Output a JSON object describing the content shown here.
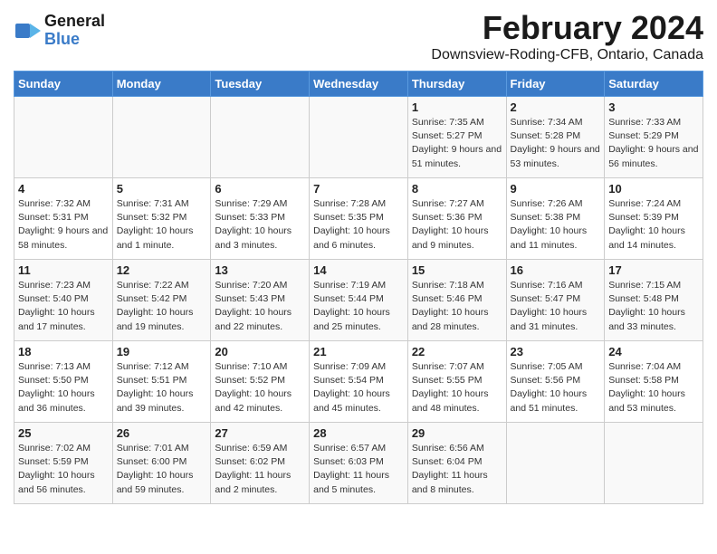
{
  "header": {
    "logo_line1": "General",
    "logo_line2": "Blue",
    "title": "February 2024",
    "subtitle": "Downsview-Roding-CFB, Ontario, Canada"
  },
  "days_of_week": [
    "Sunday",
    "Monday",
    "Tuesday",
    "Wednesday",
    "Thursday",
    "Friday",
    "Saturday"
  ],
  "weeks": [
    [
      {
        "day": "",
        "info": ""
      },
      {
        "day": "",
        "info": ""
      },
      {
        "day": "",
        "info": ""
      },
      {
        "day": "",
        "info": ""
      },
      {
        "day": "1",
        "info": "Sunrise: 7:35 AM\nSunset: 5:27 PM\nDaylight: 9 hours and 51 minutes."
      },
      {
        "day": "2",
        "info": "Sunrise: 7:34 AM\nSunset: 5:28 PM\nDaylight: 9 hours and 53 minutes."
      },
      {
        "day": "3",
        "info": "Sunrise: 7:33 AM\nSunset: 5:29 PM\nDaylight: 9 hours and 56 minutes."
      }
    ],
    [
      {
        "day": "4",
        "info": "Sunrise: 7:32 AM\nSunset: 5:31 PM\nDaylight: 9 hours and 58 minutes."
      },
      {
        "day": "5",
        "info": "Sunrise: 7:31 AM\nSunset: 5:32 PM\nDaylight: 10 hours and 1 minute."
      },
      {
        "day": "6",
        "info": "Sunrise: 7:29 AM\nSunset: 5:33 PM\nDaylight: 10 hours and 3 minutes."
      },
      {
        "day": "7",
        "info": "Sunrise: 7:28 AM\nSunset: 5:35 PM\nDaylight: 10 hours and 6 minutes."
      },
      {
        "day": "8",
        "info": "Sunrise: 7:27 AM\nSunset: 5:36 PM\nDaylight: 10 hours and 9 minutes."
      },
      {
        "day": "9",
        "info": "Sunrise: 7:26 AM\nSunset: 5:38 PM\nDaylight: 10 hours and 11 minutes."
      },
      {
        "day": "10",
        "info": "Sunrise: 7:24 AM\nSunset: 5:39 PM\nDaylight: 10 hours and 14 minutes."
      }
    ],
    [
      {
        "day": "11",
        "info": "Sunrise: 7:23 AM\nSunset: 5:40 PM\nDaylight: 10 hours and 17 minutes."
      },
      {
        "day": "12",
        "info": "Sunrise: 7:22 AM\nSunset: 5:42 PM\nDaylight: 10 hours and 19 minutes."
      },
      {
        "day": "13",
        "info": "Sunrise: 7:20 AM\nSunset: 5:43 PM\nDaylight: 10 hours and 22 minutes."
      },
      {
        "day": "14",
        "info": "Sunrise: 7:19 AM\nSunset: 5:44 PM\nDaylight: 10 hours and 25 minutes."
      },
      {
        "day": "15",
        "info": "Sunrise: 7:18 AM\nSunset: 5:46 PM\nDaylight: 10 hours and 28 minutes."
      },
      {
        "day": "16",
        "info": "Sunrise: 7:16 AM\nSunset: 5:47 PM\nDaylight: 10 hours and 31 minutes."
      },
      {
        "day": "17",
        "info": "Sunrise: 7:15 AM\nSunset: 5:48 PM\nDaylight: 10 hours and 33 minutes."
      }
    ],
    [
      {
        "day": "18",
        "info": "Sunrise: 7:13 AM\nSunset: 5:50 PM\nDaylight: 10 hours and 36 minutes."
      },
      {
        "day": "19",
        "info": "Sunrise: 7:12 AM\nSunset: 5:51 PM\nDaylight: 10 hours and 39 minutes."
      },
      {
        "day": "20",
        "info": "Sunrise: 7:10 AM\nSunset: 5:52 PM\nDaylight: 10 hours and 42 minutes."
      },
      {
        "day": "21",
        "info": "Sunrise: 7:09 AM\nSunset: 5:54 PM\nDaylight: 10 hours and 45 minutes."
      },
      {
        "day": "22",
        "info": "Sunrise: 7:07 AM\nSunset: 5:55 PM\nDaylight: 10 hours and 48 minutes."
      },
      {
        "day": "23",
        "info": "Sunrise: 7:05 AM\nSunset: 5:56 PM\nDaylight: 10 hours and 51 minutes."
      },
      {
        "day": "24",
        "info": "Sunrise: 7:04 AM\nSunset: 5:58 PM\nDaylight: 10 hours and 53 minutes."
      }
    ],
    [
      {
        "day": "25",
        "info": "Sunrise: 7:02 AM\nSunset: 5:59 PM\nDaylight: 10 hours and 56 minutes."
      },
      {
        "day": "26",
        "info": "Sunrise: 7:01 AM\nSunset: 6:00 PM\nDaylight: 10 hours and 59 minutes."
      },
      {
        "day": "27",
        "info": "Sunrise: 6:59 AM\nSunset: 6:02 PM\nDaylight: 11 hours and 2 minutes."
      },
      {
        "day": "28",
        "info": "Sunrise: 6:57 AM\nSunset: 6:03 PM\nDaylight: 11 hours and 5 minutes."
      },
      {
        "day": "29",
        "info": "Sunrise: 6:56 AM\nSunset: 6:04 PM\nDaylight: 11 hours and 8 minutes."
      },
      {
        "day": "",
        "info": ""
      },
      {
        "day": "",
        "info": ""
      }
    ]
  ]
}
